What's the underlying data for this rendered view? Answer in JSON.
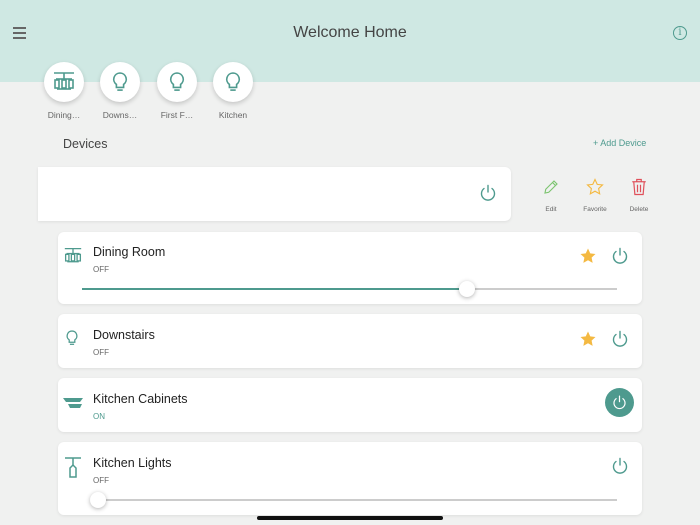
{
  "header": {
    "title": "Welcome Home"
  },
  "rooms": [
    {
      "label": "Dining…",
      "icon": "chandelier-icon"
    },
    {
      "label": "Downs…",
      "icon": "bulb-icon"
    },
    {
      "label": "First F…",
      "icon": "bulb-icon"
    },
    {
      "label": "Kitchen",
      "icon": "bulb-icon"
    }
  ],
  "devices_title": "Devices",
  "add_device": "+ Add Device",
  "swipe_actions": {
    "edit": "Edit",
    "favorite": "Favorite",
    "delete": "Delete"
  },
  "devices": [
    {
      "name": "Dining Room",
      "state": "OFF",
      "favorite": true,
      "brightness": 0.72
    },
    {
      "name": "Downstairs",
      "state": "OFF",
      "favorite": true
    },
    {
      "name": "Kitchen Cabinets",
      "state": "ON",
      "favorite": false
    },
    {
      "name": "Kitchen Lights",
      "state": "OFF",
      "favorite": false,
      "brightness": 0
    }
  ],
  "colors": {
    "accent": "#4e9a8e",
    "header": "#cfe8e3",
    "star": "#f4b942",
    "delete": "#e0505a",
    "edit": "#7cc46f"
  }
}
